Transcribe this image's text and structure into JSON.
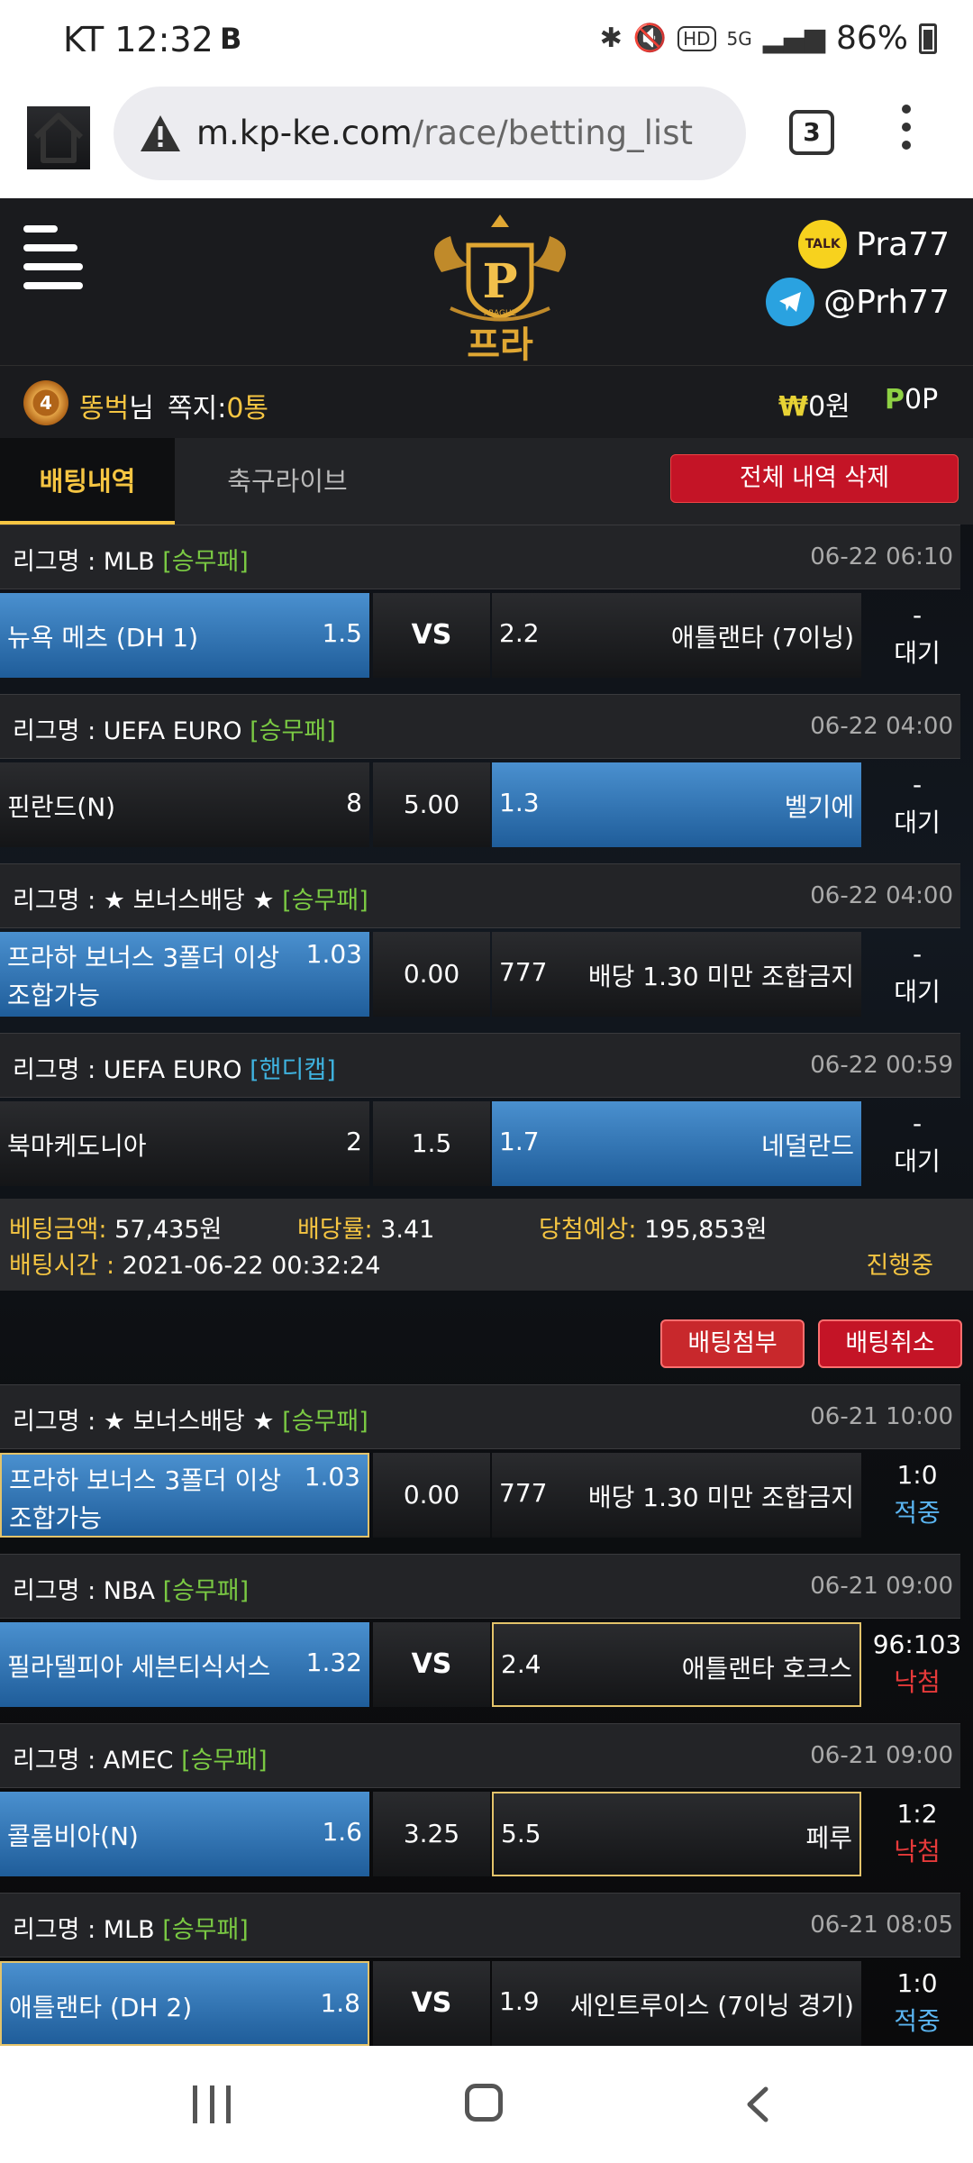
{
  "status_bar": {
    "carrier_time": "KT 12:32",
    "badge": "B",
    "battery": "86%",
    "network": "5G"
  },
  "browser": {
    "url_domain": "m.kp-ke.com",
    "url_path": "/race/betting_list",
    "tab_count": "3"
  },
  "header": {
    "logo_text": "프라하",
    "logo_small": "PRAGUE",
    "kakao_label": "TALK",
    "kakao_id": "Pra77",
    "telegram_id": "@Prh77"
  },
  "user": {
    "level": "4",
    "name": "똥벅",
    "name_suffix": "님",
    "message_label": "쪽지:",
    "message_count": "0통",
    "money_symbol": "₩",
    "money": "0원",
    "point_symbol": "P",
    "points": "0P"
  },
  "tabs": [
    {
      "label": "배팅내역"
    },
    {
      "label": "축구라이브"
    }
  ],
  "delete_all_label": "전체 내역 삭제",
  "tickets": [
    {
      "matches": [
        {
          "league": "리그명 : MLB",
          "type": "[승무패]",
          "time": "06-22 06:10",
          "home": "뉴욕 메츠 (DH 1)",
          "home_odds": "1.5",
          "mid": "VS",
          "away_odds": "2.2",
          "away": "애틀랜타 (7이닝)",
          "result_top": "-",
          "result_status": "대기"
        },
        {
          "league": "리그명 : UEFA EURO",
          "type": "[승무패]",
          "time": "06-22 04:00",
          "home": "핀란드(N)",
          "home_odds": "8",
          "mid": "5.00",
          "away_odds": "1.3",
          "away": "벨기에",
          "result_top": "-",
          "result_status": "대기"
        },
        {
          "league": "리그명 : ★ 보너스배당 ★",
          "type": "[승무패]",
          "time": "06-22 04:00",
          "home": "프라하 보너스 3폴더 이상 조합가능",
          "home_odds": "1.03",
          "mid": "0.00",
          "away_odds": "777",
          "away": "배당 1.30 미만 조합금지",
          "result_top": "-",
          "result_status": "대기"
        },
        {
          "league": "리그명 : UEFA EURO",
          "type": "[핸디캡]",
          "time": "06-22 00:59",
          "home": "북마케도니아",
          "home_odds": "2",
          "mid": "1.5",
          "away_odds": "1.7",
          "away": "네덜란드",
          "result_top": "-",
          "result_status": "대기"
        }
      ],
      "summary": {
        "amount_label": "베팅금액:",
        "amount": "57,435원",
        "rate_label": "배당률:",
        "rate": "3.41",
        "expected_label": "당첨예상:",
        "expected": "195,853원",
        "time_label": "배팅시간 :",
        "time": "2021-06-22 00:32:24",
        "status": "진행중"
      }
    },
    {
      "attach_label": "배팅첨부",
      "cancel_label": "배팅취소",
      "matches": [
        {
          "league": "리그명 : ★ 보너스배당 ★",
          "type": "[승무패]",
          "time": "06-21 10:00",
          "home": "프라하 보너스 3폴더 이상 조합가능",
          "home_odds": "1.03",
          "mid": "0.00",
          "away_odds": "777",
          "away": "배당 1.30 미만 조합금지",
          "result_top": "1:0",
          "result_status": "적중"
        },
        {
          "league": "리그명 : NBA",
          "type": "[승무패]",
          "time": "06-21 09:00",
          "home": "필라델피아 세븐티식서스",
          "home_odds": "1.32",
          "mid": "VS",
          "away_odds": "2.4",
          "away": "애틀랜타 호크스",
          "result_top": "96:103",
          "result_status": "낙첨"
        },
        {
          "league": "리그명 : AMEC",
          "type": "[승무패]",
          "time": "06-21 09:00",
          "home": "콜롬비아(N)",
          "home_odds": "1.6",
          "mid": "3.25",
          "away_odds": "5.5",
          "away": "페루",
          "result_top": "1:2",
          "result_status": "낙첨"
        },
        {
          "league": "리그명 : MLB",
          "type": "[승무패]",
          "time": "06-21 08:05",
          "home": "애틀랜타 (DH 2)",
          "home_odds": "1.8",
          "mid": "VS",
          "away_odds": "1.9",
          "away": "세인트루이스 (7이닝 경기)",
          "result_top": "1:0",
          "result_status": "적중"
        }
      ]
    }
  ],
  "colors": {
    "accent": "#f5c542",
    "win": "#5ab4f0",
    "lose": "#e63a3a",
    "selected": "#2f78bf",
    "danger": "#c41426"
  }
}
